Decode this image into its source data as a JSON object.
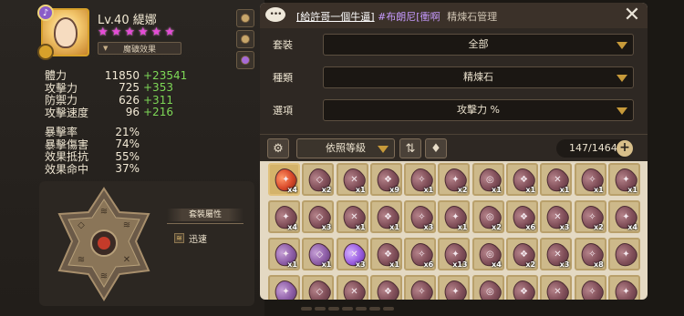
{
  "character": {
    "level_label": "Lv.40",
    "name": "緹娜",
    "stars": 6,
    "rune_effect_label": "魔礦效果"
  },
  "stats_primary": [
    {
      "label": "體力",
      "value": "11850",
      "bonus": "+23541"
    },
    {
      "label": "攻擊力",
      "value": "725",
      "bonus": "+353"
    },
    {
      "label": "防禦力",
      "value": "626",
      "bonus": "+311"
    },
    {
      "label": "攻擊速度",
      "value": "96",
      "bonus": "+216"
    }
  ],
  "stats_secondary": [
    {
      "label": "暴擊率",
      "value": "21%"
    },
    {
      "label": "暴擊傷害",
      "value": "74%"
    },
    {
      "label": "效果抵抗",
      "value": "55%"
    },
    {
      "label": "效果命中",
      "value": "37%"
    }
  ],
  "set_panel": {
    "title": "套裝屬性",
    "items": [
      {
        "icon": "speed-rune-icon",
        "label": "迅速"
      }
    ]
  },
  "header": {
    "chat_icon": "chat-bubble-icon",
    "chat_white": "[給許哥一個牛逼]",
    "chat_purple": "#布朗尼[衝啊",
    "title": "精煉石管理",
    "close_icon": "close-icon"
  },
  "filters": [
    {
      "label": "套裝",
      "value": "全部"
    },
    {
      "label": "種類",
      "value": "精煉石"
    },
    {
      "label": "選項",
      "value": "攻擊力 %"
    }
  ],
  "toolbar": {
    "settings_icon": "gear-icon",
    "sort_value": "依照等級",
    "sort_order_icon": "sort-order-icon",
    "bag_icon": "bag-icon",
    "count": "147/1464",
    "add_label": "+"
  },
  "grid_rows": [
    [
      {
        "type": "legend",
        "qty": "x4",
        "glyph": "✦"
      },
      {
        "type": "normal",
        "qty": "x2",
        "glyph": "◇"
      },
      {
        "type": "normal",
        "qty": "x1",
        "glyph": "✕"
      },
      {
        "type": "normal",
        "qty": "x9",
        "glyph": "❖"
      },
      {
        "type": "normal",
        "qty": "x1",
        "glyph": "✧"
      },
      {
        "type": "normal",
        "qty": "x2",
        "glyph": "✦"
      },
      {
        "type": "normal",
        "qty": "x1",
        "glyph": "◎"
      },
      {
        "type": "normal",
        "qty": "x1",
        "glyph": "❖"
      },
      {
        "type": "normal",
        "qty": "x1",
        "glyph": "✕"
      },
      {
        "type": "normal",
        "qty": "x1",
        "glyph": "✧"
      },
      {
        "type": "normal",
        "qty": "x1",
        "glyph": "✦"
      }
    ],
    [
      {
        "type": "normal",
        "qty": "x4",
        "glyph": "✦"
      },
      {
        "type": "normal",
        "qty": "x3",
        "glyph": "◇"
      },
      {
        "type": "normal",
        "qty": "x1",
        "glyph": "✕"
      },
      {
        "type": "normal",
        "qty": "x1",
        "glyph": "❖"
      },
      {
        "type": "normal",
        "qty": "x3",
        "glyph": "✧"
      },
      {
        "type": "normal",
        "qty": "x1",
        "glyph": "✦"
      },
      {
        "type": "normal",
        "qty": "x2",
        "glyph": "◎"
      },
      {
        "type": "normal",
        "qty": "x6",
        "glyph": "❖"
      },
      {
        "type": "normal",
        "qty": "x3",
        "glyph": "✕"
      },
      {
        "type": "normal",
        "qty": "x2",
        "glyph": "✧"
      },
      {
        "type": "normal",
        "qty": "x4",
        "glyph": "✦"
      }
    ],
    [
      {
        "type": "hero",
        "qty": "x1",
        "glyph": "✦"
      },
      {
        "type": "hero",
        "qty": "x1",
        "glyph": "◇"
      },
      {
        "type": "purple2",
        "qty": "x3",
        "glyph": "✕"
      },
      {
        "type": "normal",
        "qty": "x1",
        "glyph": "❖"
      },
      {
        "type": "normal",
        "qty": "x6",
        "glyph": "✧"
      },
      {
        "type": "normal",
        "qty": "x13",
        "glyph": "✦"
      },
      {
        "type": "normal",
        "qty": "x4",
        "glyph": "◎"
      },
      {
        "type": "normal",
        "qty": "x2",
        "glyph": "❖"
      },
      {
        "type": "normal",
        "qty": "x3",
        "glyph": "✕"
      },
      {
        "type": "normal",
        "qty": "x8",
        "glyph": "✧"
      },
      {
        "type": "normal",
        "qty": "",
        "glyph": "✦"
      }
    ],
    [
      {
        "type": "hero",
        "qty": "",
        "glyph": "✦"
      },
      {
        "type": "normal",
        "qty": "",
        "glyph": "◇"
      },
      {
        "type": "normal",
        "qty": "",
        "glyph": "✕"
      },
      {
        "type": "normal",
        "qty": "",
        "glyph": "❖"
      },
      {
        "type": "normal",
        "qty": "",
        "glyph": "✧"
      },
      {
        "type": "normal",
        "qty": "",
        "glyph": "✦"
      },
      {
        "type": "normal",
        "qty": "",
        "glyph": "◎"
      },
      {
        "type": "normal",
        "qty": "",
        "glyph": "❖"
      },
      {
        "type": "normal",
        "qty": "",
        "glyph": "✕"
      },
      {
        "type": "normal",
        "qty": "",
        "glyph": "✧"
      },
      {
        "type": "normal",
        "qty": "",
        "glyph": "✦"
      }
    ]
  ],
  "colors": {
    "bonus_green": "#7ed957",
    "star_pink": "#e64bd7",
    "panel_beige": "#e4d9c3"
  }
}
